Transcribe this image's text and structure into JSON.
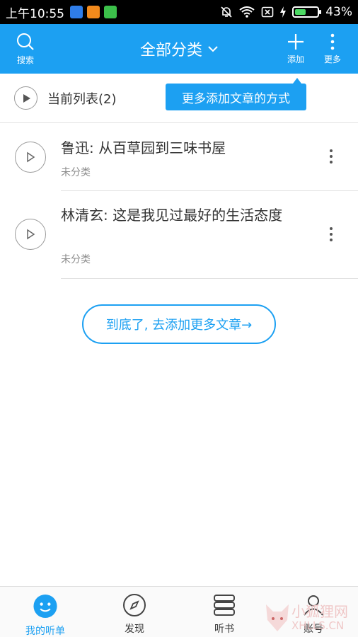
{
  "status_bar": {
    "time": "上午10:55",
    "battery": "43%",
    "battery_level": 0.43
  },
  "header": {
    "search_label": "搜索",
    "title": "全部分类",
    "add_label": "添加",
    "more_label": "更多"
  },
  "list_header": {
    "title": "当前列表(2)"
  },
  "tooltip": {
    "text": "更多添加文章的方式"
  },
  "items": [
    {
      "title": "鲁迅: 从百草园到三味书屋",
      "category": "未分类"
    },
    {
      "title": "林清玄: 这是我见过最好的生活态度",
      "category": "未分类"
    }
  ],
  "cta": {
    "label": "到底了, 去添加更多文章→"
  },
  "bottom_nav": [
    {
      "label": "我的听单"
    },
    {
      "label": "发现"
    },
    {
      "label": "听书"
    },
    {
      "label": "账号"
    }
  ],
  "watermark": {
    "text": "小狐狸网",
    "sub": "XHLLS.CN"
  },
  "colors": {
    "accent": "#1ca0f2"
  }
}
